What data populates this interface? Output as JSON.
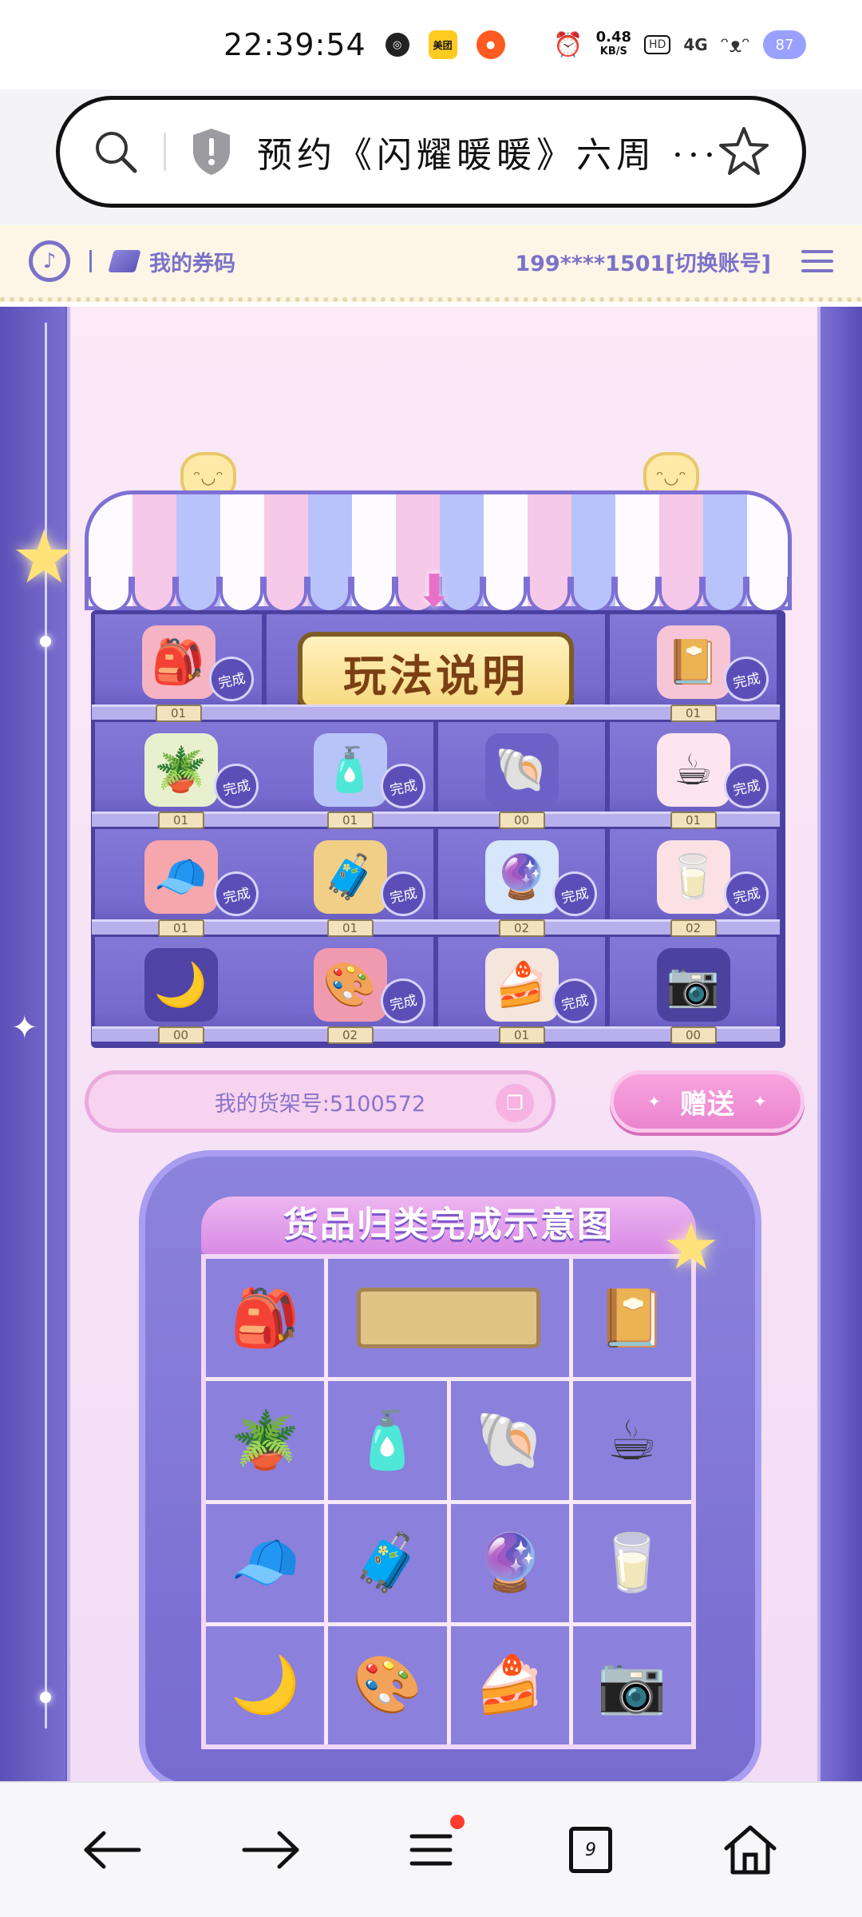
{
  "status_bar": {
    "time": "22:39:54",
    "net_speed_value": "0.48",
    "net_speed_unit": "KB/S",
    "network": "4G",
    "battery": "87",
    "app_badge": "美团"
  },
  "browser": {
    "url_text": "预约《闪耀暖暖》六周 ···",
    "tab_count": "9"
  },
  "site_header": {
    "coupon_label": "我的券码",
    "account_text": "199****1501[切换账号]"
  },
  "shelf": {
    "guide_button": "玩法说明",
    "done_label": "完成",
    "cells": [
      {
        "icon": "backpack",
        "glyph": "🎒",
        "bg": "#f6b3c2",
        "count": "01",
        "done": true
      },
      {
        "icon": "guide-button",
        "merged": true
      },
      {
        "icon": "photo-album",
        "glyph": "📔",
        "bg": "#f6c6d6",
        "count": "01",
        "done": true
      },
      {
        "icon": "flower-pot",
        "glyph": "🪴",
        "bg": "#e9f0d0",
        "count": "01",
        "done": true
      },
      {
        "icon": "perfume",
        "glyph": "🧴",
        "bg": "#b7c4f7",
        "count": "01",
        "done": true
      },
      {
        "icon": "shell",
        "glyph": "🐚",
        "bg": "#6d61c7",
        "count": "00",
        "done": false
      },
      {
        "icon": "bunny-cup",
        "glyph": "☕",
        "bg": "#fde5ef",
        "count": "01",
        "done": true
      },
      {
        "icon": "cap",
        "glyph": "🧢",
        "bg": "#f5a7ad",
        "count": "01",
        "done": true
      },
      {
        "icon": "suitcase",
        "glyph": "🧳",
        "bg": "#f1cf86",
        "count": "01",
        "done": true
      },
      {
        "icon": "crystal-ball",
        "glyph": "🔮",
        "bg": "#d6e6fb",
        "count": "02",
        "done": true
      },
      {
        "icon": "milk-carton",
        "glyph": "🥛",
        "bg": "#fbe1e4",
        "count": "02",
        "done": true
      },
      {
        "icon": "moon-pillow",
        "glyph": "🌙",
        "bg": "#4f44a6",
        "count": "00",
        "done": false
      },
      {
        "icon": "palette",
        "glyph": "🎨",
        "bg": "#f09ab0",
        "count": "02",
        "done": true
      },
      {
        "icon": "cake",
        "glyph": "🍰",
        "bg": "#f4e6dc",
        "count": "01",
        "done": true
      },
      {
        "icon": "camera",
        "glyph": "📷",
        "bg": "#4a429e",
        "count": "00",
        "done": false
      }
    ]
  },
  "shelf_number": {
    "label": "我的货架号:5100572"
  },
  "gift_button": {
    "label": "赠送",
    "star": "✦"
  },
  "guide": {
    "title": "货品归类完成示意图",
    "cells": [
      {
        "icon": "backpack",
        "glyph": "🎒"
      },
      {
        "icon": "placeholder-plaque",
        "merged": true
      },
      {
        "icon": "photo-album",
        "glyph": "📔"
      },
      {
        "icon": "flower-pot",
        "glyph": "🪴"
      },
      {
        "icon": "perfume",
        "glyph": "🧴"
      },
      {
        "icon": "shell",
        "glyph": "🐚"
      },
      {
        "icon": "bunny-cup",
        "glyph": "☕"
      },
      {
        "icon": "cap",
        "glyph": "🧢"
      },
      {
        "icon": "suitcase",
        "glyph": "🧳"
      },
      {
        "icon": "crystal-ball",
        "glyph": "🔮"
      },
      {
        "icon": "milk-carton",
        "glyph": "🥛"
      },
      {
        "icon": "moon-pillow",
        "glyph": "🌙"
      },
      {
        "icon": "palette",
        "glyph": "🎨"
      },
      {
        "icon": "cake",
        "glyph": "🍰"
      },
      {
        "icon": "camera",
        "glyph": "📷"
      }
    ]
  },
  "colors": {
    "brand_purple": "#6c5fc4",
    "accent_pink": "#ea84cf",
    "header_text": "#7b72c8"
  }
}
